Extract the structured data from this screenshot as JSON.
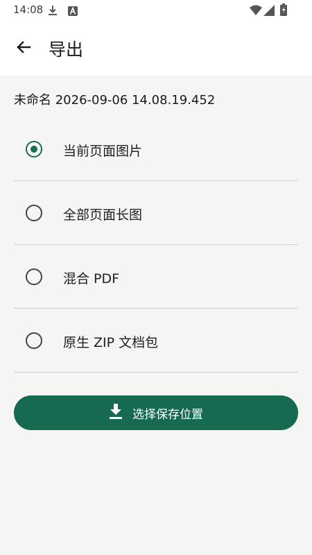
{
  "status_bar": {
    "time": "14:08",
    "icons": [
      "download-icon",
      "a-badge-icon",
      "wifi-icon",
      "signal-icon",
      "battery-icon"
    ]
  },
  "app_bar": {
    "back_icon": "back-arrow-icon",
    "title": "导出"
  },
  "file_name": "未命名 2026-09-06 14.08.19.452",
  "options": [
    {
      "label": "当前页面图片",
      "selected": true
    },
    {
      "label": "全部页面长图",
      "selected": false
    },
    {
      "label": "混合 PDF",
      "selected": false
    },
    {
      "label": "原生 ZIP 文档包",
      "selected": false
    }
  ],
  "save_button": {
    "icon": "download-icon",
    "label": "选择保存位置"
  },
  "colors": {
    "accent": "#176a52",
    "background": "#f5f5f3",
    "surface": "#ffffff",
    "divider": "#cfcfcf"
  }
}
